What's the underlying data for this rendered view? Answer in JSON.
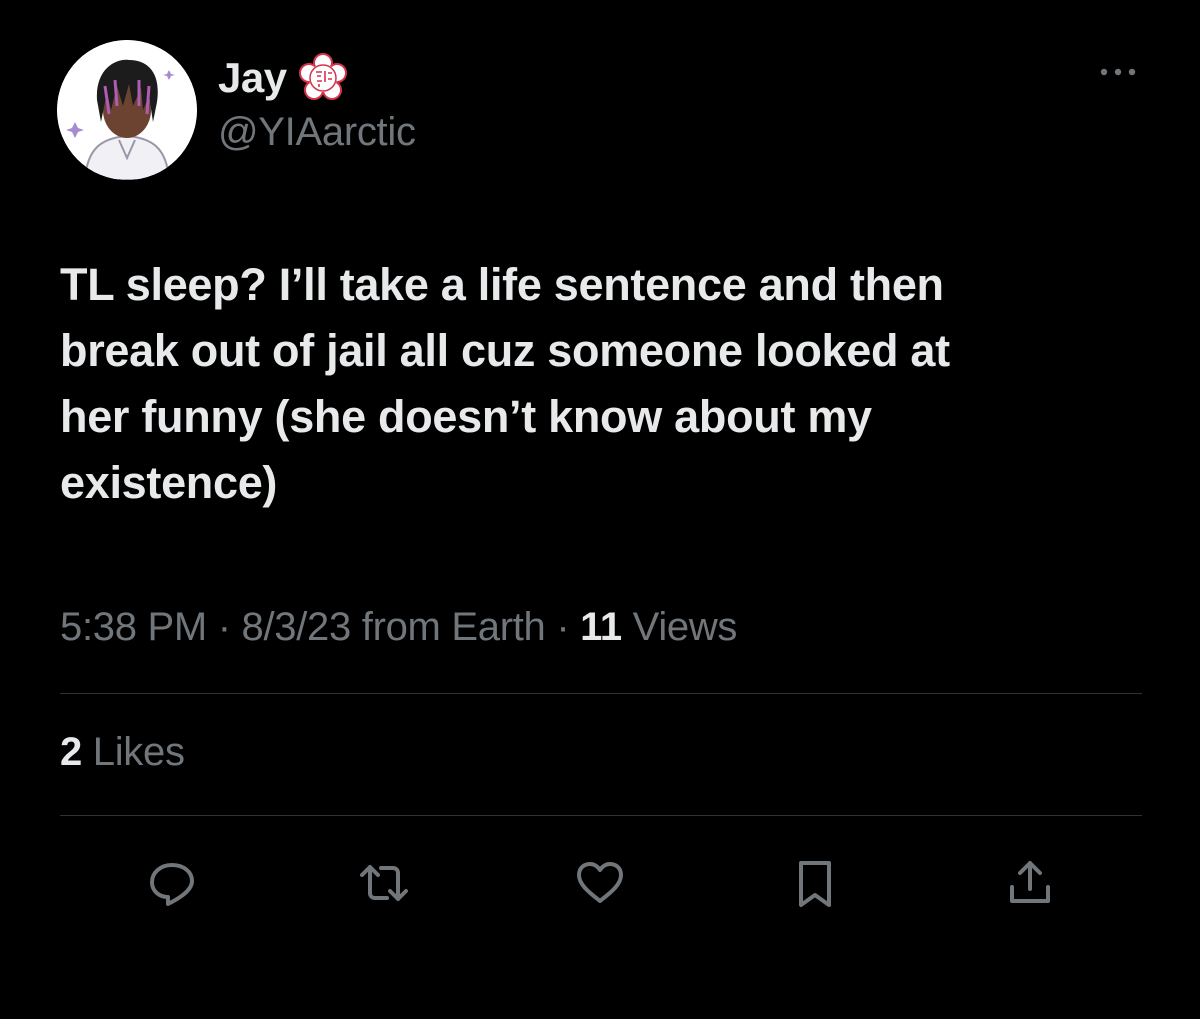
{
  "author": {
    "display_name": "Jay",
    "handle": "@YIAarctic"
  },
  "tweet": {
    "text": "TL sleep? I’ll take a life sentence and then\nbreak out of jail all cuz someone looked at\nher funny (she doesn’t know about my\nexistence)"
  },
  "meta": {
    "time": "5:38 PM",
    "separator": " · ",
    "date": "8/3/23",
    "source": " from Earth",
    "views_count": "11",
    "views_label": " Views"
  },
  "stats": {
    "likes_count": "2",
    "likes_label": " Likes"
  },
  "icons": {
    "more": "more-horizontal-icon",
    "reply": "reply-icon",
    "retweet": "retweet-icon",
    "like": "heart-icon",
    "bookmark": "bookmark-icon",
    "share": "share-icon"
  },
  "colors": {
    "background": "#000000",
    "primary_text": "#e7e9ea",
    "secondary_text": "#71767b",
    "divider": "#2f3336"
  }
}
